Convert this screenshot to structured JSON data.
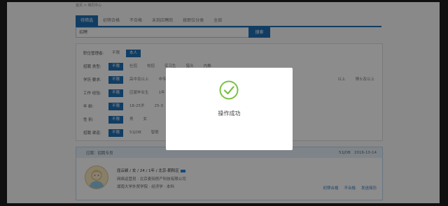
{
  "breadcrumb": "首页 > 简历中心",
  "tabs": [
    "待筛选",
    "初筛合格",
    "不合格",
    "未到应聘岗",
    "按职位分类",
    "全部"
  ],
  "search": {
    "value": "招聘",
    "button": "搜索"
  },
  "filters": [
    {
      "label": "职位管理者:",
      "options": [
        "不限",
        "本人"
      ],
      "selected": 1
    },
    {
      "label": "招聘 类型:",
      "options": [
        "不限",
        "社招",
        "校招",
        "实习生",
        "猎头",
        "内推"
      ],
      "selected": 0
    },
    {
      "label": "学历 要求:",
      "options": [
        "不限",
        "高中及以上",
        "中专"
      ],
      "selected": 0,
      "tail": [
        "以上",
        "博士及以上"
      ]
    },
    {
      "label": "工作 经验:",
      "options": [
        "不限",
        "应届毕业生",
        "1年"
      ],
      "selected": 0
    },
    {
      "label": "年 龄:",
      "options": [
        "不限",
        "18-25岁",
        "25-3"
      ],
      "selected": 0
    },
    {
      "label": "性 别:",
      "options": [
        "不限",
        "男",
        "女"
      ],
      "selected": 0
    },
    {
      "label": "招聘 渠道:",
      "options": [
        "不限",
        "51JOB",
        "智联"
      ],
      "selected": 0
    }
  ],
  "result": {
    "header_left": "应聘：招聘专员",
    "source": "51JOB",
    "date": "2016-10-14",
    "line1": "屈云颖 / 女 / 24 / 1年 / 北京-朝阳区",
    "line2": "网络运营员 · 北京麦田房产科技有限公司",
    "line3": "湖南大学外贸学院 · 经济学 · 本科",
    "actions": [
      "初筛合格",
      "不合格",
      "发送简历"
    ]
  },
  "modal": {
    "message": "操作成功"
  },
  "colors": {
    "accent": "#1f6fb5",
    "success": "#7ac143"
  }
}
